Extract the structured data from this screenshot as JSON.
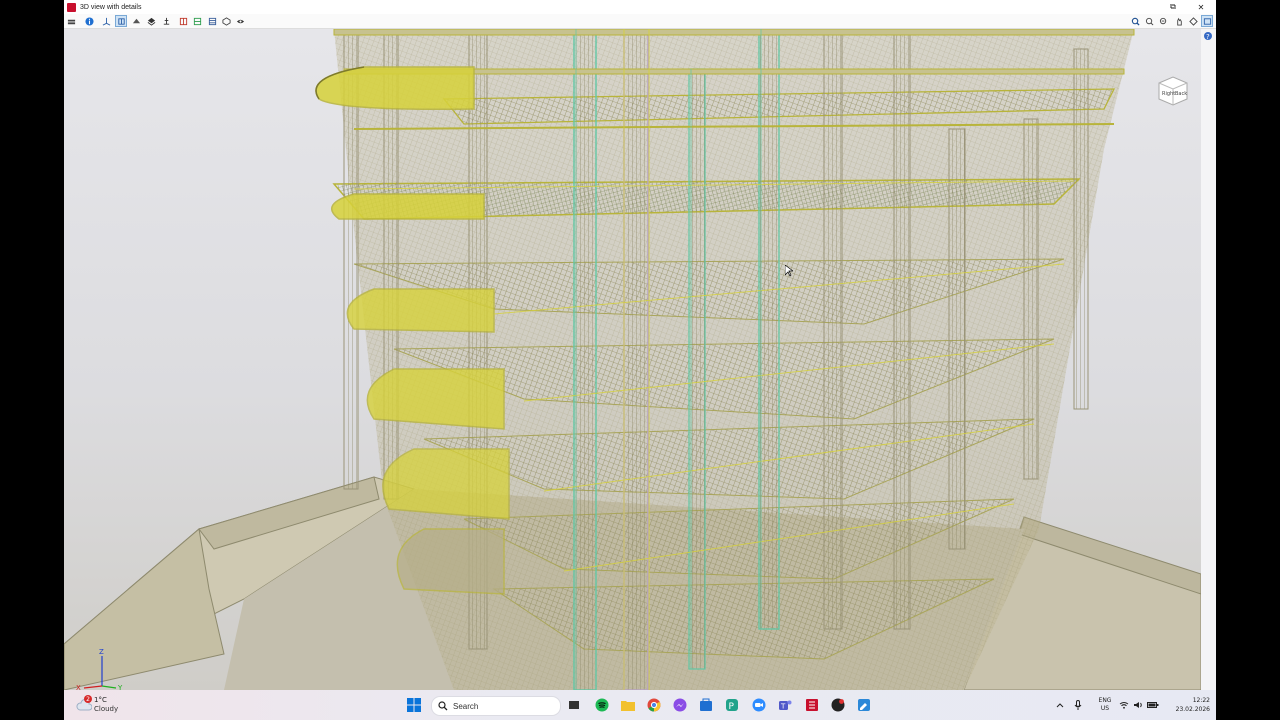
{
  "window": {
    "title": "3D view with details",
    "controls": {
      "restore": "⧉",
      "close": "✕"
    }
  },
  "toolbar": {
    "left_icons": [
      "layers-icon",
      "info-icon",
      "axis-icon",
      "section-icon",
      "view-icon",
      "render-icon",
      "object-icon",
      "box-icon",
      "grid-icon",
      "frame-icon",
      "filter-icon",
      "cube-icon",
      "eye-icon"
    ],
    "right_icons": [
      "zoom-extents-icon",
      "zoom-in-icon",
      "zoom-window-icon",
      "pan-icon",
      "rotate-icon",
      "view-options-icon",
      "print-icon",
      "help-icon"
    ]
  },
  "navcube": {
    "left_label": "Right",
    "right_label": "Back"
  },
  "axes": {
    "z": "Z",
    "x": "X",
    "y": "Y"
  },
  "taskbar": {
    "weather": {
      "temp": "1°C",
      "condition": "Cloudy",
      "badge": "2"
    },
    "search_label": "Search",
    "language": {
      "line1": "ENG",
      "line2": "US"
    },
    "clock": {
      "time": "12:22",
      "date": "23.02.2026"
    }
  },
  "colors": {
    "rebar_yellow": "#d7d23a",
    "rebar_green": "#62c7a5",
    "concrete": "#b7b29a",
    "app_red": "#c8102e",
    "win_blue": "#0a74da"
  }
}
